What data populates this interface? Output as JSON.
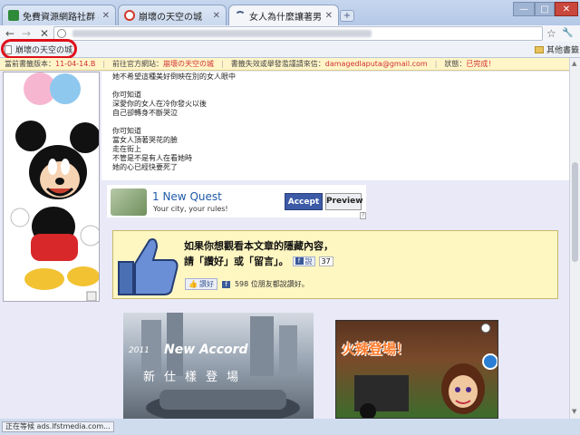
{
  "tabs": [
    {
      "title": "免費資源網路社群 — 免…",
      "favicon_color": "#2f8a3a",
      "active": false
    },
    {
      "title": "崩壞の天空の城",
      "favicon_color": "#d23a2a",
      "active": false
    },
    {
      "title": "女人為什麼讓著男人搶著…",
      "favicon_color": "#4a5f86",
      "active": true
    }
  ],
  "new_tab_label": "+",
  "window_controls": {
    "minimize": "—",
    "maximize": "□",
    "close": "✕"
  },
  "toolbar": {
    "back": "←",
    "forward": "→",
    "stop": "✕",
    "star": "☆",
    "wrench": "🔧"
  },
  "bookmarks": {
    "item_label": "崩壞の天空の城",
    "other_label": "其他書籤"
  },
  "infobar": {
    "version_label": "當前書籤版本：",
    "version_value": "11-04-14.B",
    "official_label": "前往官方網站：",
    "official_value": "崩壞の天空の城",
    "report_label": "書籤失效或舉發濫謹請來信：",
    "report_email": "damagedlaputa@gmail.com",
    "status_label": "狀態：",
    "status_value": "已完成！"
  },
  "poem_lines": [
    "她不希望這種美好倒映在別的女人眼中",
    "",
    "你可知道",
    "深愛你的女人在冷你發火以後",
    "自己卻轉身不斷哭泣",
    "",
    "你可知道",
    "當女人頂著哭花的臉",
    "走在街上",
    "不管是不是有人在看她時",
    "她的心已經快要死了"
  ],
  "ad": {
    "title": "1 New Quest",
    "subtitle": "Your city, your rules!",
    "accept": "Accept",
    "preview": "Preview",
    "adchoice": "?"
  },
  "facebook": {
    "line1": "如果你想觀看本文章的隱藏內容，",
    "line2": "請「讚好」或「留言」。",
    "comment_btn": "說",
    "comment_count": "37",
    "like_btn": "讚好",
    "like_count_text": "598 位朋友都說讚好。"
  },
  "banner1": {
    "year": "2011",
    "model": "New Accord",
    "slogan": "新仕樣登場"
  },
  "banner2": {
    "title": "火辣登場！"
  },
  "status_text": "正在等候 ads.lfstmedia.com..."
}
